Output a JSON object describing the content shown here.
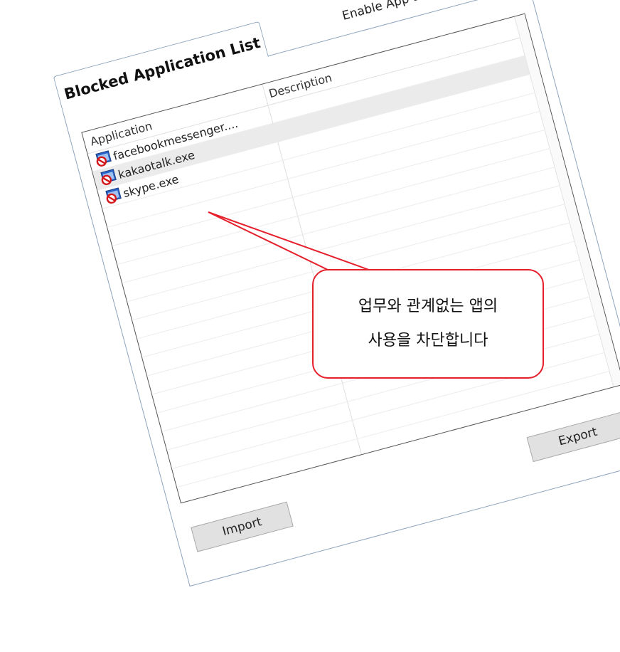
{
  "header": {
    "tab_label": "Blocked Application List",
    "enable_label": "Enable App Blocker",
    "enable_checked": true
  },
  "list": {
    "columns": [
      "Application",
      "Description"
    ],
    "rows": [
      {
        "name": "facebookmessenger....",
        "description": "",
        "icon": "blocked-app-icon"
      },
      {
        "name": "kakaotalk.exe",
        "description": "",
        "icon": "blocked-app-icon"
      },
      {
        "name": "skype.exe",
        "description": "",
        "icon": "blocked-app-icon"
      }
    ]
  },
  "buttons": {
    "import_label": "Import",
    "export_label": "Export"
  },
  "callout": {
    "line1": "업무와 관계없는 앱의",
    "line2": "사용을 차단합니다",
    "color": "#e5202c"
  }
}
